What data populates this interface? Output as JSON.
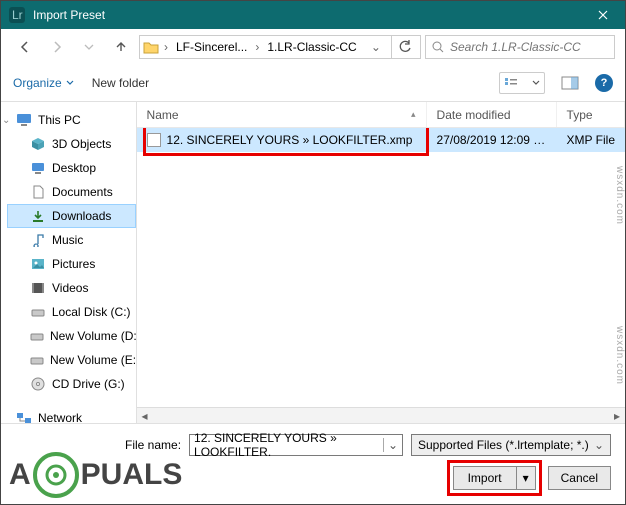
{
  "window": {
    "title": "Import Preset"
  },
  "nav": {
    "path": {
      "folder1": "LF-Sincerel...",
      "folder2": "1.LR-Classic-CC"
    },
    "search_placeholder": "Search 1.LR-Classic-CC"
  },
  "toolbar": {
    "organize": "Organize",
    "new_folder": "New folder"
  },
  "tree": {
    "root": "This PC",
    "items": [
      "3D Objects",
      "Desktop",
      "Documents",
      "Downloads",
      "Music",
      "Pictures",
      "Videos",
      "Local Disk (C:)",
      "New Volume (D:)",
      "New Volume (E:)",
      "CD Drive (G:)"
    ],
    "network": "Network"
  },
  "columns": {
    "name": "Name",
    "date": "Date modified",
    "type": "Type"
  },
  "file": {
    "name": "12. SINCERELY YOURS » LOOKFILTER.xmp",
    "date": "27/08/2019 12:09 …",
    "type": "XMP File"
  },
  "footer": {
    "filename_label": "File name:",
    "filename_value": "12. SINCERELY YOURS » LOOKFILTER.",
    "filter_label": "Supported Files (*.lrtemplate; *.)",
    "import": "Import",
    "cancel": "Cancel"
  },
  "watermark": {
    "a1": "A",
    "center": "?",
    "a2": "PUALS"
  },
  "side": {
    "top": "wsxdn.com",
    "bottom": "wsxdn.com"
  }
}
